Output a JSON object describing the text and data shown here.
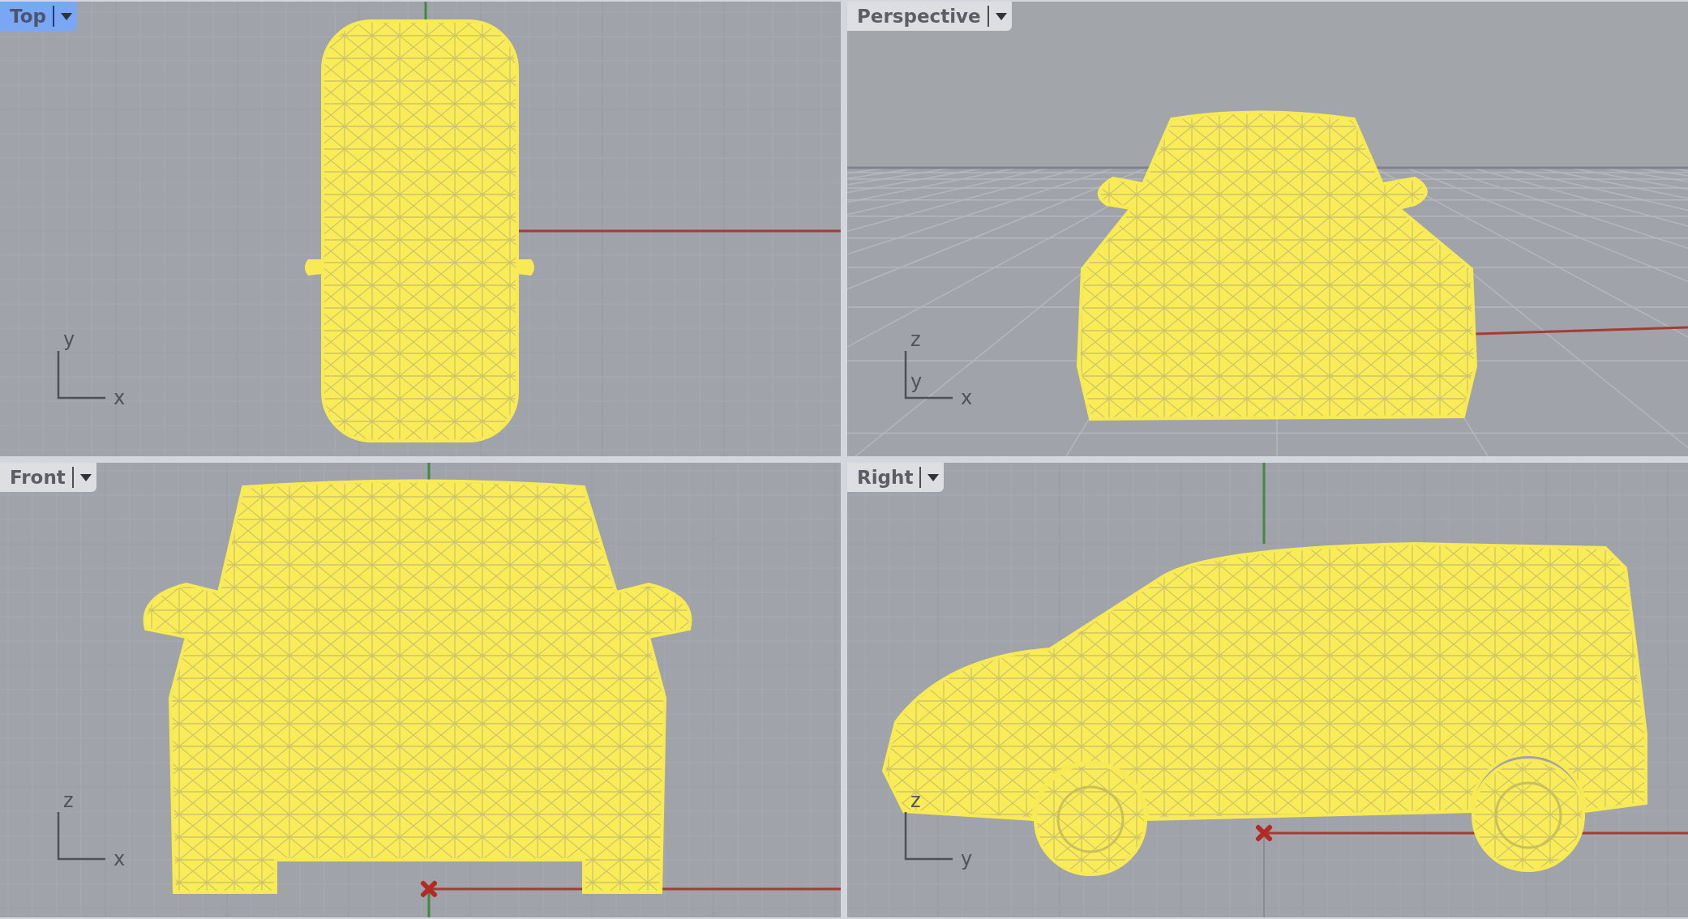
{
  "viewports": [
    {
      "kind": "top",
      "label": "Top",
      "selected": true,
      "axes": [
        "y",
        "x"
      ]
    },
    {
      "kind": "perspective",
      "label": "Perspective",
      "selected": false,
      "axes": [
        "z",
        "y",
        "x"
      ]
    },
    {
      "kind": "front",
      "label": "Front",
      "selected": false,
      "axes": [
        "z",
        "x"
      ]
    },
    {
      "kind": "right",
      "label": "Right",
      "selected": false,
      "axes": [
        "z",
        "y"
      ]
    }
  ]
}
